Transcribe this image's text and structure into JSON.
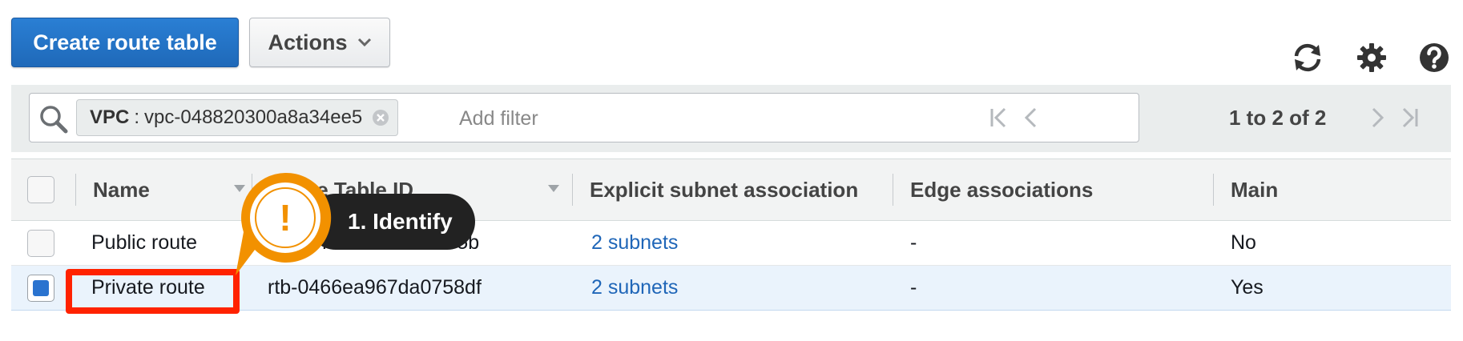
{
  "toolbar": {
    "create_label": "Create route table",
    "actions_label": "Actions"
  },
  "filter": {
    "token_key": "VPC",
    "token_separator": ":",
    "token_value": "vpc-048820300a8a34ee5",
    "placeholder": "Add filter"
  },
  "pagination": {
    "text": "1 to 2 of 2"
  },
  "table": {
    "columns": {
      "name": "Name",
      "route_table_id": "Route Table ID",
      "explicit_subnet": "Explicit subnet association",
      "edge": "Edge associations",
      "main": "Main"
    },
    "rows": [
      {
        "name": "Public route",
        "route_table_id": "rtb-0872b674fcc929e5b",
        "explicit_subnet": "2 subnets",
        "edge": "-",
        "main": "No",
        "selected": false
      },
      {
        "name": "Private route",
        "route_table_id": "rtb-0466ea967da0758df",
        "explicit_subnet": "2 subnets",
        "edge": "-",
        "main": "Yes",
        "selected": true
      }
    ]
  },
  "annotation": {
    "step_label": "1. Identify",
    "marker_symbol": "!"
  },
  "colors": {
    "primary_button": "#1f69b9",
    "link": "#1f66b8",
    "highlight_border": "#ff2200",
    "callout_marker": "#f29100",
    "selected_row": "#eaf3fc"
  }
}
